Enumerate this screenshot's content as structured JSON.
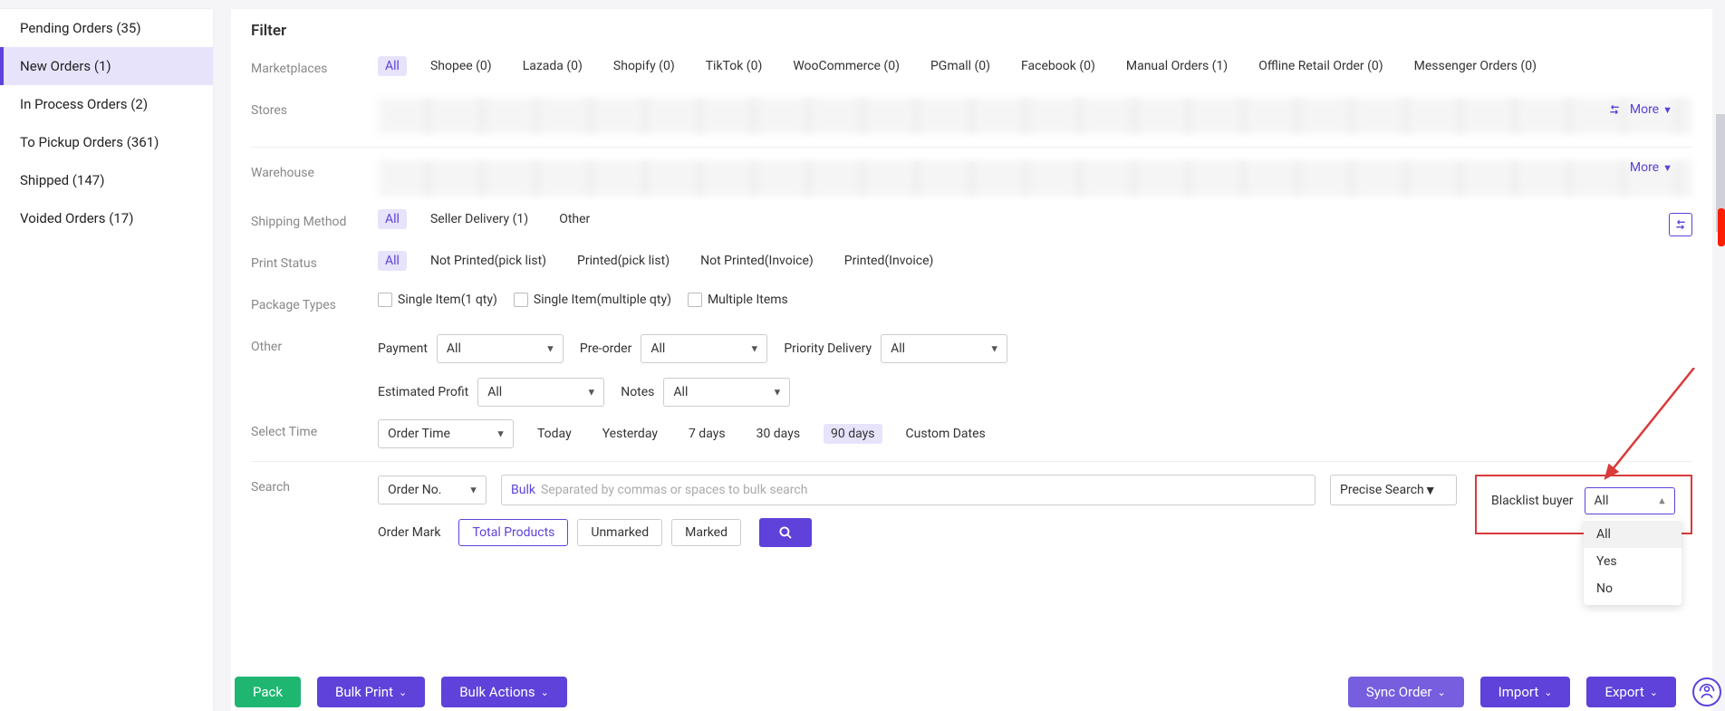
{
  "sidebar": {
    "items": [
      {
        "label": "Pending Orders (35)",
        "active": false
      },
      {
        "label": "New Orders (1)",
        "active": true
      },
      {
        "label": "In Process Orders (2)",
        "active": false
      },
      {
        "label": "To Pickup Orders (361)",
        "active": false
      },
      {
        "label": "Shipped (147)",
        "active": false
      },
      {
        "label": "Voided Orders (17)",
        "active": false
      }
    ]
  },
  "filter": {
    "title": "Filter",
    "marketplaces": {
      "label": "Marketplaces",
      "options": [
        {
          "t": "All",
          "active": true
        },
        {
          "t": "Shopee (0)"
        },
        {
          "t": "Lazada (0)"
        },
        {
          "t": "Shopify (0)"
        },
        {
          "t": "TikTok (0)"
        },
        {
          "t": "WooCommerce (0)"
        },
        {
          "t": "PGmall (0)"
        },
        {
          "t": "Facebook (0)"
        },
        {
          "t": "Manual Orders (1)"
        },
        {
          "t": "Offline Retail Order (0)"
        },
        {
          "t": "Messenger Orders (0)"
        }
      ]
    },
    "stores": {
      "label": "Stores",
      "more": "More"
    },
    "warehouse": {
      "label": "Warehouse",
      "more": "More"
    },
    "shipping": {
      "label": "Shipping Method",
      "options": [
        {
          "t": "All",
          "active": true
        },
        {
          "t": "Seller Delivery (1)"
        },
        {
          "t": "Other"
        }
      ]
    },
    "print_status": {
      "label": "Print Status",
      "options": [
        {
          "t": "All",
          "active": true
        },
        {
          "t": "Not Printed(pick list)"
        },
        {
          "t": "Printed(pick list)"
        },
        {
          "t": "Not Printed(Invoice)"
        },
        {
          "t": "Printed(Invoice)"
        }
      ]
    },
    "package_types": {
      "label": "Package Types",
      "options": [
        {
          "t": "Single Item(1 qty)"
        },
        {
          "t": "Single Item(multiple qty)"
        },
        {
          "t": "Multiple Items"
        }
      ]
    },
    "other": {
      "label": "Other",
      "payment": {
        "label": "Payment",
        "value": "All"
      },
      "preorder": {
        "label": "Pre-order",
        "value": "All"
      },
      "priority": {
        "label": "Priority Delivery",
        "value": "All"
      },
      "profit": {
        "label": "Estimated Profit",
        "value": "All"
      },
      "notes": {
        "label": "Notes",
        "value": "All"
      }
    },
    "select_time": {
      "label": "Select Time",
      "dropdown": "Order Time",
      "ranges": [
        {
          "t": "Today"
        },
        {
          "t": "Yesterday"
        },
        {
          "t": "7 days"
        },
        {
          "t": "30 days"
        },
        {
          "t": "90 days",
          "sel": true
        },
        {
          "t": "Custom Dates"
        }
      ]
    },
    "search": {
      "label": "Search",
      "field": "Order No.",
      "bulk": "Bulk",
      "placeholder": "Separated by commas or spaces to bulk search",
      "mode": "Precise Search"
    },
    "blacklist": {
      "label": "Blacklist buyer",
      "value": "All",
      "options": [
        "All",
        "Yes",
        "No"
      ]
    },
    "order_mark": {
      "label": "Order Mark",
      "options": [
        {
          "t": "Total Products",
          "active": true
        },
        {
          "t": "Unmarked"
        },
        {
          "t": "Marked"
        }
      ]
    }
  },
  "footer": {
    "pack": "Pack",
    "bulk_print": "Bulk Print",
    "bulk_actions": "Bulk Actions",
    "sync": "Sync Order",
    "import": "Import",
    "export": "Export"
  }
}
